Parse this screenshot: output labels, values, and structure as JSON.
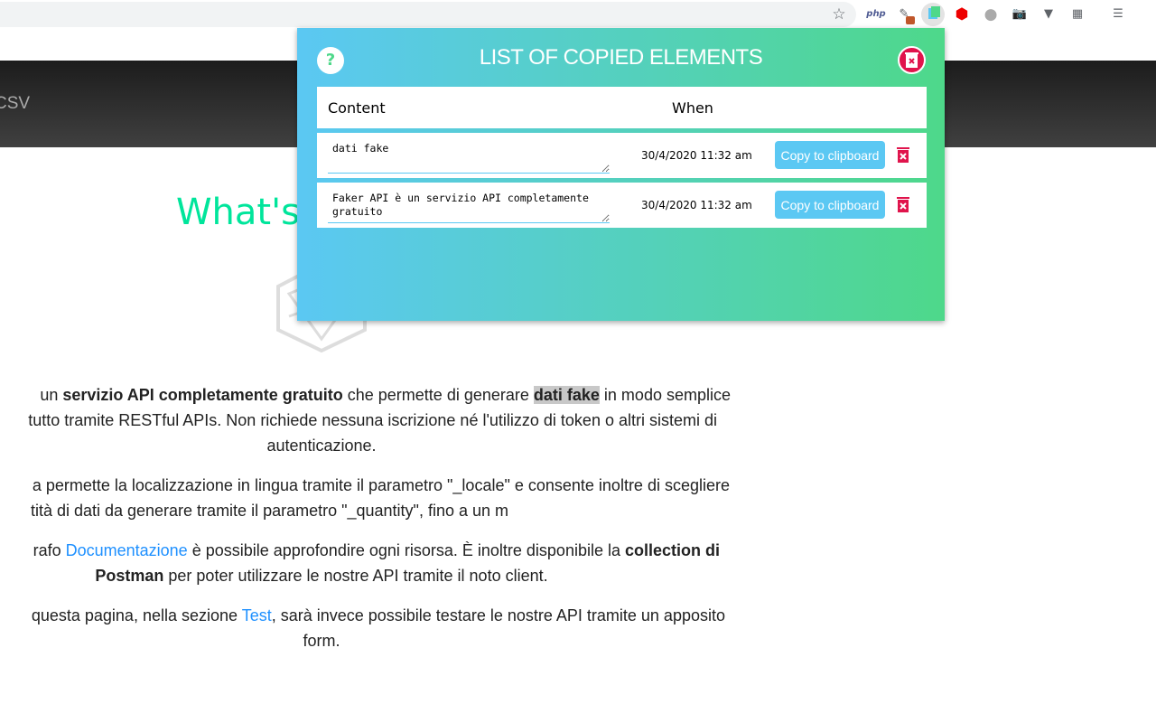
{
  "browser": {
    "extensions": [
      "star-icon",
      "php-icon",
      "eyedropper-icon",
      "copy-elements-icon",
      "adblock-icon",
      "cookie-icon",
      "camera-icon",
      "vue-icon",
      "sheet-icon",
      "playlist-icon"
    ],
    "php_label": "php"
  },
  "site": {
    "nav_item": "CSV",
    "title": "What's",
    "accent": "#00e59b",
    "p1": {
      "l1a": "un ",
      "l1b": "servizio API completamente gratuito",
      "l1c": " che permette di generare ",
      "l1d": "dati fake",
      "l1e": " in modo semplice",
      "l2": "tutto tramite RESTful APIs. Non richiede nessuna iscrizione né l'utilizzo di token o altri sistemi di",
      "l3": "autenticazione."
    },
    "p2": {
      "l1": "a permette la localizzazione in lingua tramite il parametro \"_locale\" e consente inoltre di scegliere",
      "l2": "tità di dati da generare tramite il parametro \"_quantity\", fino a un m"
    },
    "p3": {
      "l1a": "rafo ",
      "l1b": "Documentazione",
      "l1c": " è possibile approfondire ogni risorsa. È inoltre disponibile la ",
      "l1d": "collection di",
      "l2a": "Postman",
      "l2b": " per poter utilizzare le nostre API tramite il noto client."
    },
    "p4": {
      "l1a": " questa pagina, nella sezione ",
      "l1b": "Test",
      "l1c": ", sarà invece possibile testare le nostre API tramite un apposito",
      "l2": "form."
    }
  },
  "popup": {
    "title": "LIST OF COPIED ELEMENTS",
    "help": "?",
    "columns": {
      "content": "Content",
      "when": "When"
    },
    "items": [
      {
        "content": "dati fake",
        "when": "30/4/2020 11:32 am",
        "copy_label": "Copy to clipboard"
      },
      {
        "content": "Faker API è un servizio API completamente gratuito",
        "when": "30/4/2020 11:32 am",
        "copy_label": "Copy to clipboard"
      }
    ],
    "colors": {
      "gradient_start": "#5bc8f3",
      "gradient_end": "#4ed88a",
      "danger": "#e0144c"
    }
  }
}
